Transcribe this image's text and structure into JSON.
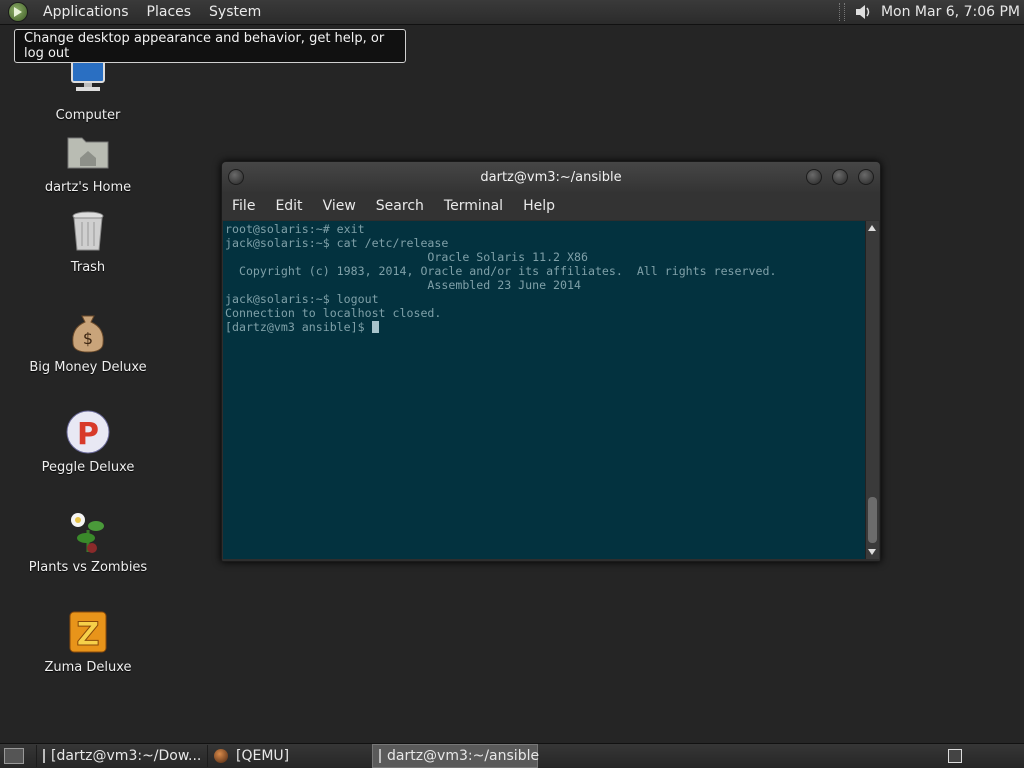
{
  "top_panel": {
    "menus": [
      "Applications",
      "Places",
      "System"
    ],
    "clock": "Mon Mar  6,  7:06 PM"
  },
  "tooltip": "Change desktop appearance and behavior, get help, or log out",
  "desktop_icons": [
    {
      "label": "Computer",
      "icon": "computer-icon"
    },
    {
      "label": "dartz's Home",
      "icon": "home-folder-icon"
    },
    {
      "label": "Trash",
      "icon": "trash-icon"
    },
    {
      "label": "Big Money Deluxe",
      "icon": "money-bag-icon"
    },
    {
      "label": "Peggle Deluxe",
      "icon": "peggle-icon"
    },
    {
      "label": "Plants vs Zombies",
      "icon": "plants-icon"
    },
    {
      "label": "Zuma Deluxe",
      "icon": "zuma-icon"
    }
  ],
  "terminal": {
    "title": "dartz@vm3:~/ansible",
    "menus": [
      "File",
      "Edit",
      "View",
      "Search",
      "Terminal",
      "Help"
    ],
    "lines": [
      "root@solaris:~# exit",
      "jack@solaris:~$ cat /etc/release",
      "                             Oracle Solaris 11.2 X86",
      "  Copyright (c) 1983, 2014, Oracle and/or its affiliates.  All rights reserved.",
      "                             Assembled 23 June 2014",
      "jack@solaris:~$ logout",
      "Connection to localhost closed.",
      "[dartz@vm3 ansible]$ "
    ]
  },
  "taskbar": {
    "tasks": [
      {
        "label": "[dartz@vm3:~/Dow...",
        "icon": "terminal-icon",
        "active": false
      },
      {
        "label": "[QEMU]",
        "icon": "qemu-icon",
        "active": false
      },
      {
        "label": "dartz@vm3:~/ansible",
        "icon": "terminal-icon",
        "active": true
      }
    ]
  },
  "colors": {
    "terminal_bg": "#03323f",
    "terminal_fg": "#7fa0a8",
    "desktop_bg": "#252525"
  }
}
